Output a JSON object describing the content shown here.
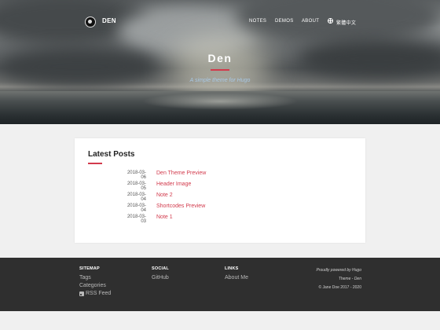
{
  "site": {
    "brand": "DEN",
    "nav": [
      {
        "label": "NOTES"
      },
      {
        "label": "DEMOS"
      },
      {
        "label": "ABOUT"
      },
      {
        "label": "繁體中文"
      }
    ]
  },
  "hero": {
    "title": "Den",
    "subtitle": "A simple theme for Hugo"
  },
  "latest": {
    "heading": "Latest Posts",
    "posts": [
      {
        "date": "2018-03-06",
        "title": "Den Theme Preview"
      },
      {
        "date": "2018-03-05",
        "title": "Header Image"
      },
      {
        "date": "2018-03-04",
        "title": "Note 2"
      },
      {
        "date": "2018-03-04",
        "title": "Shortcodes Preview"
      },
      {
        "date": "2018-03-03",
        "title": "Note 1"
      }
    ]
  },
  "footer": {
    "sitemap": {
      "heading": "SITEMAP",
      "links": [
        "Tags",
        "Categories",
        "RSS Feed"
      ]
    },
    "social": {
      "heading": "SOCIAL",
      "links": [
        "GitHub"
      ]
    },
    "links": {
      "heading": "LINKS",
      "links": [
        "About Me"
      ]
    },
    "powered": "Proudly powered by Hugo",
    "theme": "Theme - Den",
    "copyright": "© Jane Doe 2017 - 2020"
  },
  "colors": {
    "accent": "#d23a4c",
    "subtitle": "#a9c9e6",
    "footer_bg": "#2f2f2f",
    "page_bg": "#f0f0f0"
  },
  "icons": {
    "logo": "yin-yang-logo-icon",
    "language": "globe-icon",
    "feed": "rss-icon"
  }
}
